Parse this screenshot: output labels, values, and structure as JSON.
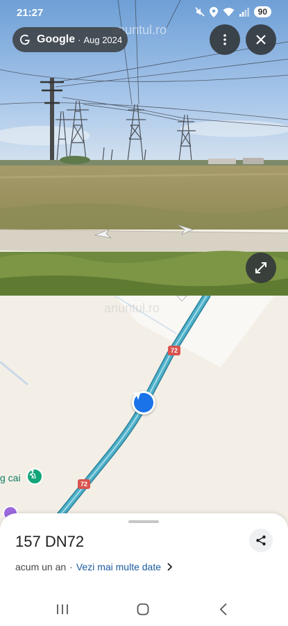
{
  "status_bar": {
    "time": "21:27",
    "battery": "90"
  },
  "street_view": {
    "brand": "Google",
    "separator": "·",
    "date": "Aug 2024",
    "watermark": "anuntul.ro"
  },
  "map": {
    "route_shield_1": "72",
    "route_shield_2": "72",
    "poi_label": "g cai",
    "watermark": "anuntul.ro"
  },
  "place_sheet": {
    "title": "157 DN72",
    "age": "acum un an",
    "separator": "·",
    "more_dates_link": "Vezi mai multe date"
  },
  "colors": {
    "road": "#4fb1c9",
    "road_edge": "#2a7f98",
    "shield": "#d9534f",
    "location_marker": "#1a73e8",
    "poi_green": "#12a57a",
    "link": "#1a5a9e"
  },
  "icons": [
    "mute-icon",
    "location-icon",
    "wifi-icon",
    "signal-icon",
    "more-vert-icon",
    "close-icon",
    "fullscreen-icon",
    "share-icon",
    "chevron-right-icon",
    "recents-icon",
    "home-icon",
    "back-icon"
  ]
}
